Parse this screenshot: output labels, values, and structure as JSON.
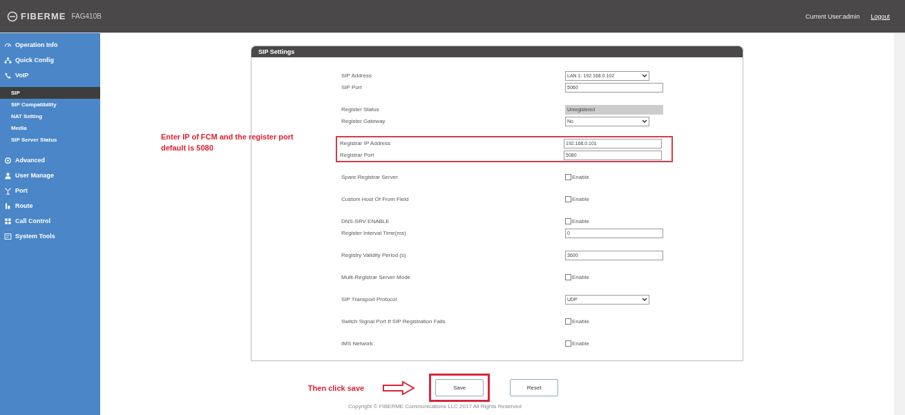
{
  "header": {
    "logo": "FIBERME",
    "model": "FAG410B",
    "user": "Current User:admin",
    "logout": "Logout"
  },
  "sidebar": {
    "items": [
      {
        "label": "Operation Info",
        "selected": false
      },
      {
        "label": "Quick Config",
        "selected": false
      },
      {
        "label": "VoIP",
        "selected": false,
        "children": [
          {
            "label": "SIP",
            "selected": true
          },
          {
            "label": "SIP Compatibility",
            "selected": false
          },
          {
            "label": "NAT Setting",
            "selected": false
          },
          {
            "label": "Media",
            "selected": false
          },
          {
            "label": "SIP Server Status",
            "selected": false
          }
        ]
      },
      {
        "label": "Advanced",
        "selected": false
      },
      {
        "label": "User Manage",
        "selected": false
      },
      {
        "label": "Port",
        "selected": false
      },
      {
        "label": "Route",
        "selected": false
      },
      {
        "label": "Call Control",
        "selected": false
      },
      {
        "label": "System Tools",
        "selected": false
      }
    ]
  },
  "panel": {
    "title": "SIP Settings",
    "sections": [
      {
        "highlighted": false,
        "rows": [
          {
            "label": "SIP Address",
            "kind": "select",
            "value": "LAN 1: 192.168.0.102"
          },
          {
            "label": "SIP Port",
            "kind": "text",
            "value": "5060"
          }
        ]
      },
      {
        "highlighted": false,
        "rows": [
          {
            "label": "Register Status",
            "kind": "status",
            "value": "Unregistered"
          },
          {
            "label": "Register Gateway",
            "kind": "select",
            "value": "No"
          }
        ]
      },
      {
        "highlighted": true,
        "rows": [
          {
            "label": "Registrar IP Address",
            "kind": "text",
            "value": "192.168.0.101"
          },
          {
            "label": "Registrar Port",
            "kind": "text",
            "value": "5080"
          }
        ]
      },
      {
        "highlighted": false,
        "rows": [
          {
            "label": "Spare Registrar Server",
            "kind": "checkbox",
            "value": "Enable",
            "checked": false
          }
        ]
      },
      {
        "highlighted": false,
        "rows": [
          {
            "label": "Custom Host Of From Field",
            "kind": "checkbox",
            "value": "Enable",
            "checked": false
          }
        ]
      },
      {
        "highlighted": false,
        "rows": [
          {
            "label": "DNS-SRV ENABLE",
            "kind": "checkbox",
            "value": "Enable",
            "checked": false
          },
          {
            "label": "Register Interval Time(ms)",
            "kind": "text",
            "value": "0"
          }
        ]
      },
      {
        "highlighted": false,
        "rows": [
          {
            "label": "Registry Validity Period (s)",
            "kind": "text",
            "value": "3600"
          }
        ]
      },
      {
        "highlighted": false,
        "rows": [
          {
            "label": "Multi-Registrar Server Mode",
            "kind": "checkbox",
            "value": "Enable",
            "checked": false
          }
        ]
      },
      {
        "highlighted": false,
        "rows": [
          {
            "label": "SIP Transport Protocol",
            "kind": "select",
            "value": "UDP"
          }
        ]
      },
      {
        "highlighted": false,
        "rows": [
          {
            "label": "Switch Signal Port If SIP Registration Fails",
            "kind": "checkbox",
            "value": "Enable",
            "checked": false
          }
        ]
      },
      {
        "highlighted": false,
        "rows": [
          {
            "label": "IMS Network",
            "kind": "checkbox",
            "value": "Enable",
            "checked": false
          }
        ]
      }
    ]
  },
  "annotations": {
    "registrar_note": "Enter IP of FCM and the register port default is 5080",
    "save_note": "Then click save"
  },
  "buttons": [
    {
      "label": "Save",
      "highlighted": true
    },
    {
      "label": "Reset",
      "highlighted": false
    }
  ],
  "footer": "Copyright © FIBERME Communications LLC 2017 All Rights Reserved"
}
